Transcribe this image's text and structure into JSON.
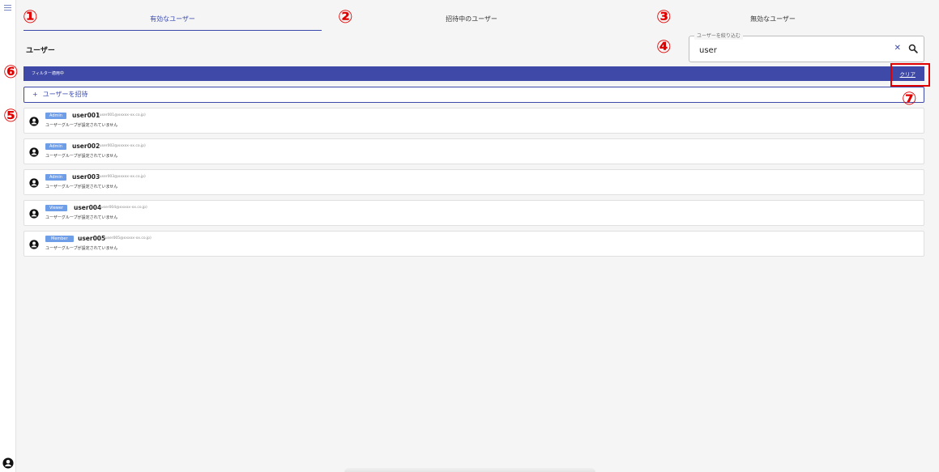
{
  "tabs": [
    {
      "label": "有効なユーザー",
      "active": true
    },
    {
      "label": "招待中のユーザー",
      "active": false
    },
    {
      "label": "無効なユーザー",
      "active": false
    }
  ],
  "markers": [
    "①",
    "②",
    "③",
    "④",
    "⑤",
    "⑥",
    "⑦"
  ],
  "page": {
    "title": "ユーザー"
  },
  "filter": {
    "legend": "ユーザーを絞り込む",
    "value": "user",
    "clear_icon": "close-icon",
    "search_icon": "search-icon"
  },
  "filter_bar": {
    "label": "フィルター適用中",
    "clear_label": "クリア"
  },
  "invite": {
    "plus": "+",
    "label": "ユーザーを招待"
  },
  "users": [
    {
      "role": "Admin",
      "name": "user001",
      "email": "(user001@xxxxx-xx.co.jp)",
      "group": "ユーザーグループが設定されていません"
    },
    {
      "role": "Admin",
      "name": "user002",
      "email": "(user002@xxxxx-xx.co.jp)",
      "group": "ユーザーグループが設定されていません"
    },
    {
      "role": "Admin",
      "name": "user003",
      "email": "(user003@xxxxx-xx.co.jp)",
      "group": "ユーザーグループが設定されていません"
    },
    {
      "role": "Viewer",
      "name": "user004",
      "email": "(user004@xxxxx-xx.co.jp)",
      "group": "ユーザーグループが設定されていません"
    },
    {
      "role": "Member",
      "name": "user005",
      "email": "(user005@xxxxx-xx.co.jp)",
      "group": "ユーザーグループが設定されていません"
    }
  ],
  "colors": {
    "accent": "#3f4aa8",
    "badge": "#6f9ee8",
    "marker": "#e00000"
  }
}
